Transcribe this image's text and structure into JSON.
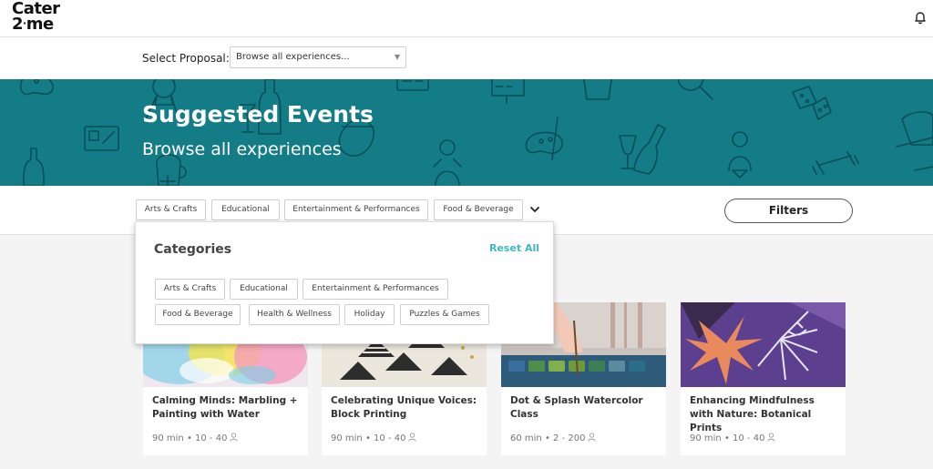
{
  "header": {
    "logo_line1": "Cater",
    "logo_line2a": "2",
    "logo_dot": "·",
    "logo_line2b": "me",
    "icons": [
      "bell-icon"
    ]
  },
  "proposal": {
    "label": "Select Proposal:",
    "selected": "Browse all experiences..."
  },
  "hero": {
    "title": "Suggested Events",
    "subtitle": "Browse all experiences",
    "background_color": "#137c87"
  },
  "category_strip": {
    "chips": [
      "Arts & Crafts",
      "Educational",
      "Entertainment & Performances",
      "Food & Beverage"
    ],
    "filters_label": "Filters"
  },
  "dropdown": {
    "title": "Categories",
    "reset_label": "Reset All",
    "accent_color": "#3fb8c0",
    "row1": [
      "Arts & Crafts",
      "Educational",
      "Entertainment & Performances"
    ],
    "row2": [
      "Food & Beverage",
      "Health & Wellness",
      "Holiday",
      "Puzzles & Games"
    ]
  },
  "cards": [
    {
      "title": "Calming Minds: Marbling + Painting with Water",
      "meta": "90 min • 10 - 40"
    },
    {
      "title": "Celebrating Unique Voices: Block Printing",
      "meta": "90 min • 10 - 40"
    },
    {
      "title": "Dot & Splash Watercolor Class",
      "meta": "60 min • 2 - 200"
    },
    {
      "title": "Enhancing Mindfulness with Nature: Botanical Prints",
      "meta": "90 min • 10 - 40"
    }
  ]
}
